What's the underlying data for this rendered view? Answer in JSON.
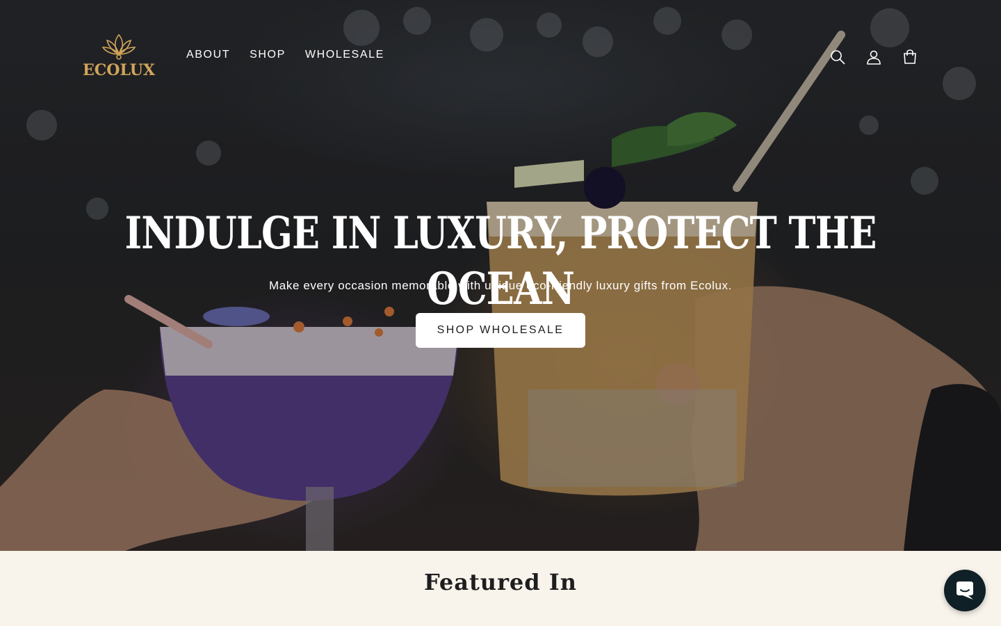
{
  "brand": {
    "name": "ECOLUX",
    "accent": "#d1a45a"
  },
  "nav": {
    "items": [
      {
        "label": "ABOUT"
      },
      {
        "label": "SHOP"
      },
      {
        "label": "WHOLESALE"
      }
    ]
  },
  "header_icons": [
    "search-icon",
    "account-icon",
    "cart-icon"
  ],
  "hero": {
    "title": "INDULGE IN LUXURY, PROTECT THE OCEAN",
    "subtitle": "Make every occasion memorable with unique eco-friendly luxury gifts from Ecolux.",
    "button_label": "SHOP WHOLESALE"
  },
  "featured": {
    "title": "Featured In"
  },
  "chat": {
    "icon": "chat-icon",
    "color": "#0f2026"
  }
}
